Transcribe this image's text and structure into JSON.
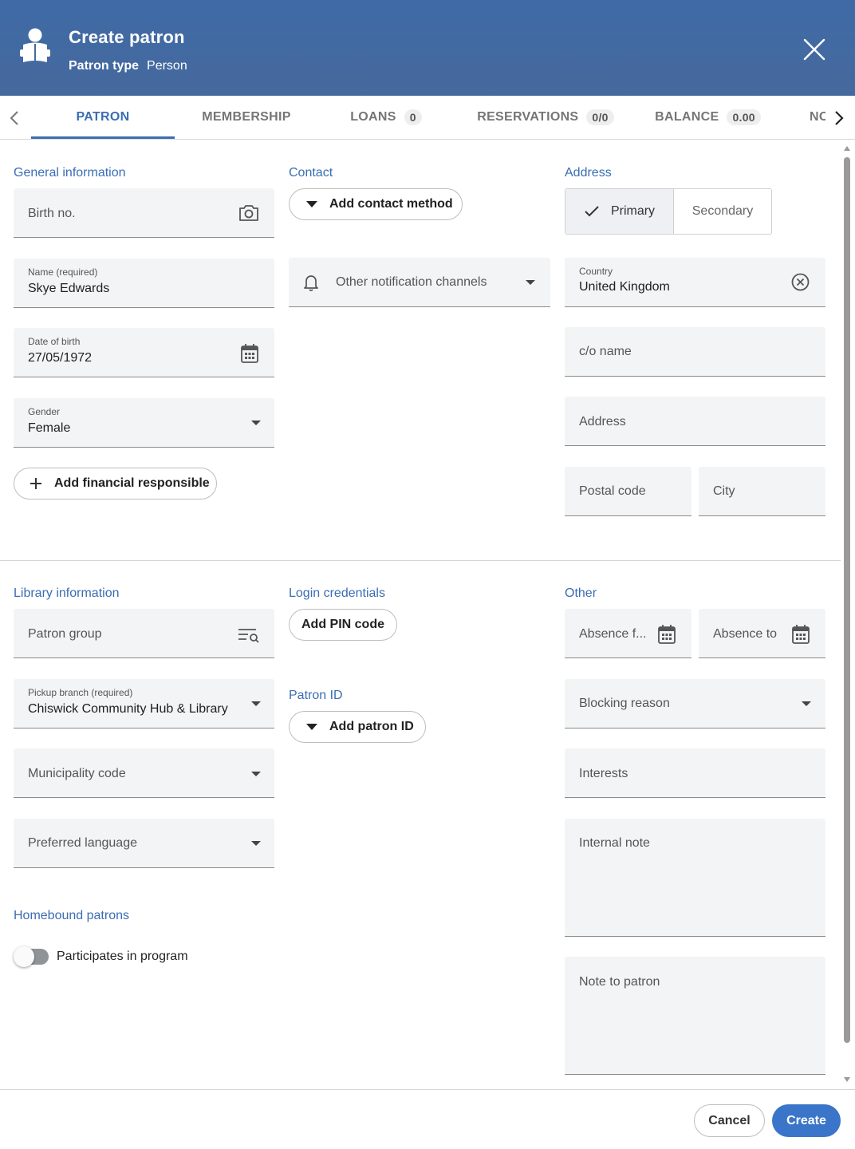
{
  "header": {
    "title": "Create patron",
    "patron_type_label": "Patron type",
    "patron_type_value": "Person",
    "icon": "patron-reading-icon",
    "close_icon": "close-icon",
    "background": "#46699d"
  },
  "tabs": {
    "items": [
      {
        "label": "PATRON",
        "count": null,
        "active": true
      },
      {
        "label": "MEMBERSHIP",
        "count": null
      },
      {
        "label": "LOANS",
        "count": "0"
      },
      {
        "label": "RESERVATIONS",
        "count": "0/0"
      },
      {
        "label": "BALANCE",
        "count": "0.00"
      },
      {
        "label": "NO",
        "count": null
      }
    ],
    "accent": "#3a6db3"
  },
  "general": {
    "title": "General information",
    "birth_no_placeholder": "Birth no.",
    "name_label": "Name (required)",
    "name_value": "Skye Edwards",
    "dob_label": "Date of birth",
    "dob_value": "27/05/1972",
    "gender_label": "Gender",
    "gender_value": "Female",
    "add_financial_label": "Add financial responsible"
  },
  "contact": {
    "title": "Contact",
    "add_contact_label": "Add contact method",
    "other_channels_placeholder": "Other notification channels"
  },
  "address": {
    "title": "Address",
    "primary_label": "Primary",
    "secondary_label": "Secondary",
    "country_label": "Country",
    "country_value": "United Kingdom",
    "co_name_placeholder": "c/o name",
    "address_placeholder": "Address",
    "postal_placeholder": "Postal code",
    "city_placeholder": "City"
  },
  "library": {
    "title": "Library information",
    "patron_group_placeholder": "Patron group",
    "pickup_label": "Pickup branch (required)",
    "pickup_value": "Chiswick Community Hub & Library",
    "municipality_placeholder": "Municipality code",
    "language_placeholder": "Preferred language"
  },
  "login": {
    "title": "Login credentials",
    "add_pin_label": "Add PIN code"
  },
  "patron_id": {
    "title": "Patron ID",
    "add_id_label": "Add patron ID"
  },
  "other": {
    "title": "Other",
    "absence_from_placeholder": "Absence f...",
    "absence_to_placeholder": "Absence to",
    "blocking_placeholder": "Blocking reason",
    "interests_placeholder": "Interests",
    "internal_note_placeholder": "Internal note",
    "note_to_patron_placeholder": "Note to patron"
  },
  "homebound": {
    "title": "Homebound patrons",
    "participates_label": "Participates in program",
    "participates_on": false
  },
  "footer": {
    "cancel_label": "Cancel",
    "create_label": "Create",
    "create_color": "#3a75c9"
  }
}
